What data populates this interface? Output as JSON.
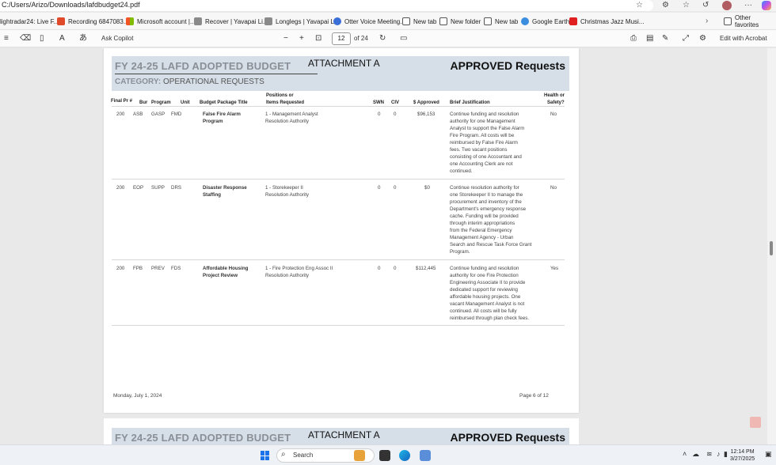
{
  "browser": {
    "url": "C:/Users/Arizo/Downloads/lafdbudget24.pdf",
    "bookmarks": [
      {
        "label": "lightradar24: Live F...",
        "color": "#f0a030"
      },
      {
        "label": "Recording 6847083...",
        "color": "#e04a2a"
      },
      {
        "label": "Microsoft account |...",
        "color": "#2b88d8"
      },
      {
        "label": "Recover | Yavapai Li...",
        "color": "#6a6a6a"
      },
      {
        "label": "Longlegs | Yavapai L...",
        "color": "#6a6a6a"
      },
      {
        "label": "Otter Voice Meeting...",
        "color": "#3a6fd8"
      },
      {
        "label": "New tab",
        "color": "#777777"
      },
      {
        "label": "New folder",
        "color": "#777777"
      },
      {
        "label": "New tab",
        "color": "#777777"
      },
      {
        "label": "Google Earth",
        "color": "#3b8de0"
      },
      {
        "label": "Christmas Jazz Musi...",
        "color": "#e02020"
      }
    ],
    "other_favorites": "Other favorites"
  },
  "pdf_toolbar": {
    "ask_copilot": "Ask Copilot",
    "page_current": "12",
    "page_total": "of 24",
    "edit_with_acrobat": "Edit with Acrobat"
  },
  "document": {
    "title": "FY 24-25 LAFD ADOPTED BUDGET",
    "attachment": "ATTACHMENT A",
    "approved": "APPROVED Requests",
    "category_label": "CATEGORY:",
    "category_value": "OPERATIONAL REQUESTS",
    "headers": {
      "final_pr": "Final Pr #",
      "bur": "Bur",
      "program": "Program",
      "unit": "Unit",
      "package_title": "Budget Package Title",
      "positions_1": "Positions or",
      "positions_2": "Items Requested",
      "swn": "SWN",
      "civ": "CIV",
      "approved": "$ Approved",
      "justification": "Brief Justification",
      "health_1": "Health or",
      "health_2": "Safety?"
    },
    "rows": [
      {
        "final_pr": "200",
        "bur": "ASB",
        "program": "GASP",
        "unit": "FMD",
        "title_1": "False Fire Alarm",
        "title_2": "Program",
        "pos_1": "1 - Management Analyst",
        "pos_2": "Resolution Authority",
        "swn": "0",
        "civ": "0",
        "approved": "$96,153",
        "just": [
          "Continue funding and resolution",
          "authority for one Management",
          "Analyst to support the False Alarm",
          "Fire Program.  All costs will be",
          "reimbursed by False Fire Alarm",
          "fees.  Two vacant positions",
          "consisting of one Accountant and",
          "one Accounting Clerk are not",
          "continued."
        ],
        "health": "No"
      },
      {
        "final_pr": "200",
        "bur": "EOP",
        "program": "SUPP",
        "unit": "DRS",
        "title_1": "Disaster Response",
        "title_2": "Staffing",
        "pos_1": "1 - Storekeeper II",
        "pos_2": "Resolution Authority",
        "swn": "0",
        "civ": "0",
        "approved": "$0",
        "just": [
          "Continue resolution authority for",
          "one Storekeeper II to manage the",
          "procurement and inventory of the",
          "Department's emergency response",
          "cache.  Funding will be provided",
          "through interim appropriations",
          "from the Federal Emergency",
          "Management Agency - Urban",
          "Search and Rescue Task Force Grant",
          "Program."
        ],
        "health": "No"
      },
      {
        "final_pr": "200",
        "bur": "FPB",
        "program": "PREV",
        "unit": "FDS",
        "title_1": "Affordable Housing",
        "title_2": "Project Review",
        "pos_1": "1 - Fire Protection Eng Assoc II",
        "pos_2": "Resolution Authority",
        "swn": "0",
        "civ": "0",
        "approved": "$112,445",
        "just": [
          "Continue funding and resolution",
          "authority for one Fire Protection",
          "Engineering Associate II to provide",
          "dedicated support for reviewing",
          "affordable housing projects.  One",
          "vacant Management Analyst is not",
          "continued.  All costs will be fully",
          "reimbursed through plan check fees."
        ],
        "health": "Yes"
      }
    ],
    "footer_date": "Monday, July 1, 2024",
    "footer_page": "Page 6 of 12"
  },
  "taskbar": {
    "search_placeholder": "Search",
    "time": "12:14 PM",
    "date": "3/27/2025"
  }
}
